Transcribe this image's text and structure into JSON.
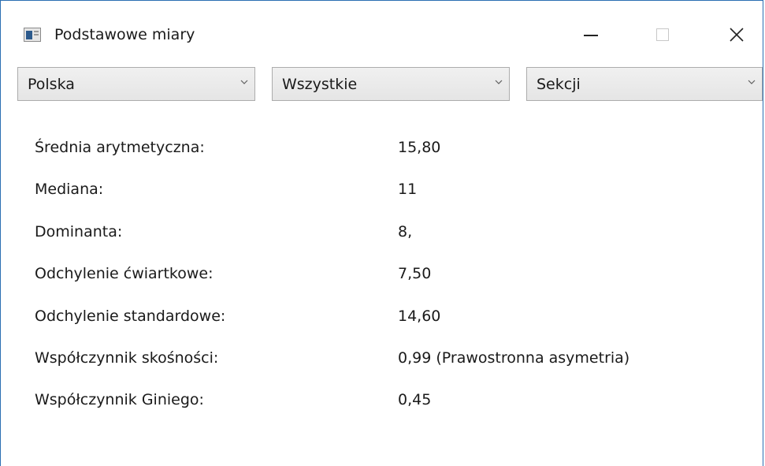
{
  "window": {
    "title": "Podstawowe miary",
    "icon": "app-window-icon"
  },
  "controls": {
    "minimize_icon": "minimize-icon",
    "maximize_icon": "maximize-icon",
    "close_icon": "close-icon"
  },
  "filters": [
    {
      "value": "Polska"
    },
    {
      "value": "Wszystkie"
    },
    {
      "value": "Sekcji"
    }
  ],
  "stats": [
    {
      "label": "Średnia arytmetyczna:",
      "value": "15,80"
    },
    {
      "label": "Mediana:",
      "value": "11"
    },
    {
      "label": "Dominanta:",
      "value": "8,"
    },
    {
      "label": "Odchylenie ćwiartkowe:",
      "value": "7,50"
    },
    {
      "label": "Odchylenie standardowe:",
      "value": "14,60"
    },
    {
      "label": "Współczynnik skośności:",
      "value": "0,99 (Prawostronna asymetria)"
    },
    {
      "label": "Współczynnik Giniego:",
      "value": "0,45"
    }
  ],
  "colors": {
    "window_border": "#2b6fb2",
    "combo_border": "#acacac",
    "app_icon_accent": "#2c5a8c"
  }
}
